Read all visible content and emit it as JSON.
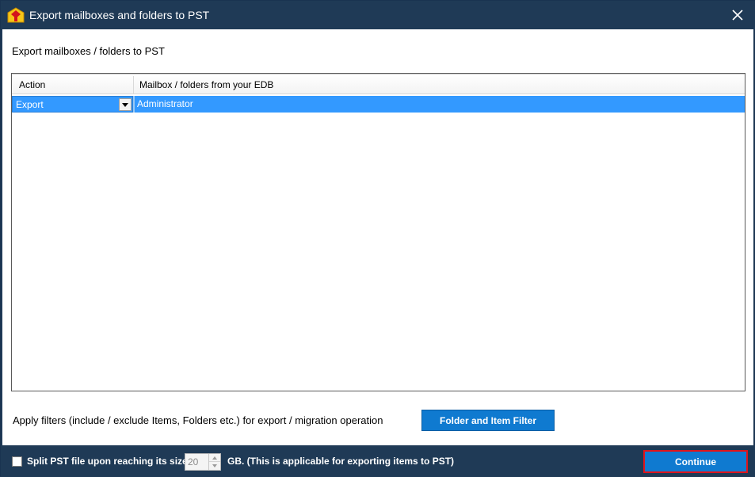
{
  "window": {
    "title": "Export mailboxes and folders to PST",
    "close_icon": "close-icon",
    "app_icon": "app-logo-icon"
  },
  "main": {
    "heading": "Export mailboxes / folders to PST",
    "grid": {
      "columns": [
        "Action",
        "Mailbox / folders from your EDB"
      ],
      "rows": [
        {
          "action": "Export",
          "mailbox": "Administrator",
          "selected": true
        }
      ]
    },
    "filter": {
      "label": "Apply filters (include / exclude Items, Folders etc.) for export / migration operation",
      "button_label": "Folder and Item Filter"
    }
  },
  "footer": {
    "split_label": "Split PST file upon reaching its size",
    "split_checked": false,
    "size_value": "20",
    "gb_label": "GB. (This is applicable for exporting items to PST)",
    "continue_label": "Continue"
  },
  "colors": {
    "titlebar": "#1f3a56",
    "accent_button": "#0f7ad0",
    "selection": "#3399ff",
    "highlight_border": "#e0141b"
  }
}
